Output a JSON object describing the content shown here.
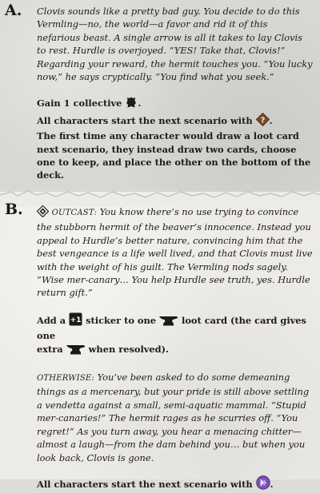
{
  "section_a": {
    "letter": "A.",
    "narrative": "Clovis sounds like a pretty bad guy. You decide to do this Vermling—no, the world—a favor and rid it of this nefarious beast. A single arrow is all it takes to lay Clovis to rest. Hurdle is overjoyed. “YES! Take that, Clovis!” Regarding your reward, the hermit touches you. “You lucky now,” he says cryptically. “You find what you seek.”",
    "gain_prefix": "Gain 1 collective",
    "gain_suffix": ".",
    "start_prefix": "All characters start the next scenario with",
    "start_suffix": ".",
    "rule": "The first time any character would draw a loot card next scenario, they instead draw two cards, choose one to keep, and place the other on the bottom of the deck.",
    "colors": {
      "hide_icon": "#1c1c1c",
      "loot_icon": "#7a4a2a"
    }
  },
  "section_b": {
    "letter": "B.",
    "outcast_label": "OUTCAST:",
    "outcast_text": "You know there’s no use trying to convince the stubborn hermit of the beaver’s innocence. Instead you appeal to Hurdle’s better nature, convincing him that the best vengeance is a life well lived, and that Clovis must live with the weight of his guilt. The Vermling nods sagely. “Wise mer-canary… You help Hurdle see truth, yes. Hurdle return gift.”",
    "add_prefix": "Add a",
    "sticker_label": "+1",
    "add_middle": "sticker to one",
    "add_suffix_1": "loot card (the card gives one",
    "add_extra": "extra",
    "add_suffix_2": "when resolved).",
    "otherwise_label": "OTHERWISE:",
    "otherwise_text": "You’ve been asked to do some demeaning things as a mercenary, but your pride is still above settling a vendetta against a small, semi-aquatic mammal. “Stupid mer-canaries!” The hermit rages as he scurries off. “You regret!” As you turn away, you hear a menacing chitter—almost a laugh—from the dam behind you… but when you look back, Clovis is gone.",
    "final_prefix": "All characters start the next scenario with",
    "final_suffix": ".",
    "colors": {
      "sticker": "#1b1b1b",
      "anvil": "#1b1b1b",
      "curse_icon": "#7b4fb0"
    }
  }
}
